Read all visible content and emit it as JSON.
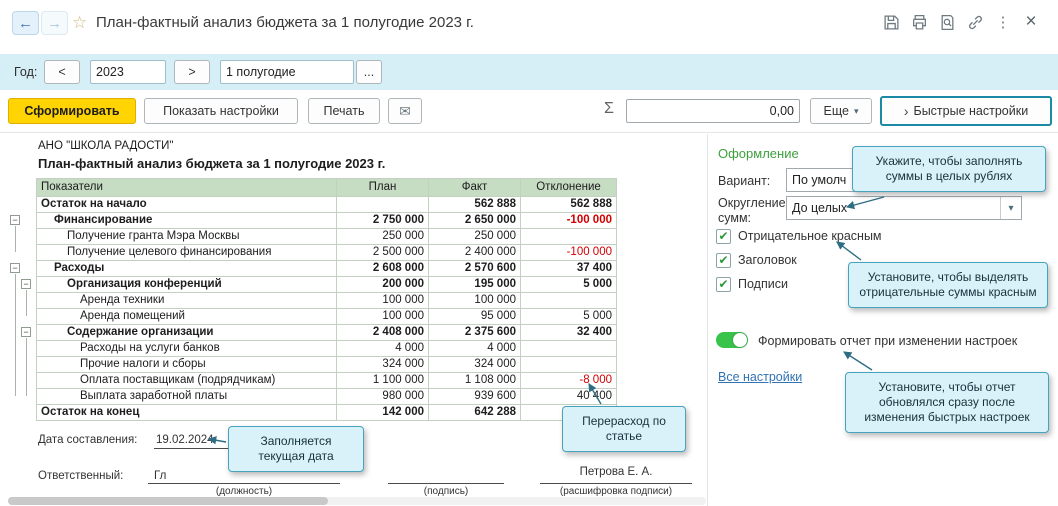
{
  "glyphs": {
    "back": "←",
    "forward": "→",
    "star": "☆",
    "more_v": "⋮",
    "close": "×",
    "mail": "✉",
    "sigma": "Σ",
    "combo_arrow": "▾",
    "chevron": "›",
    "minus": "−",
    "check": "✔",
    "dots": "..."
  },
  "icons": [
    "floppy-disk",
    "printer",
    "magnifier-document",
    "chain-link",
    "vertical-dots",
    "cross",
    "envelope",
    "star-outline",
    "back-arrow",
    "forward-arrow"
  ],
  "titlebar": {
    "title": "План-фактный анализ бюджета за 1 полугодие 2023 г."
  },
  "filterbar": {
    "year_label": "Год:",
    "prev": "<",
    "year": "2023",
    "next": ">",
    "period": "1 полугодие"
  },
  "toolbar": {
    "generate": "Сформировать",
    "show_settings": "Показать настройки",
    "print": "Печать",
    "sum_value": "0,00",
    "more": "Еще",
    "quick_settings": "Быстрые настройки"
  },
  "report": {
    "organization": "АНО \"ШКОЛА РАДОСТИ\"",
    "title": "План-фактный анализ бюджета за 1 полугодие 2023 г.",
    "columns": [
      "Показатели",
      "План",
      "Факт",
      "Отклонение"
    ],
    "rows": [
      {
        "label": "Остаток на начало",
        "plan": "",
        "fact": "562 888",
        "dev": "562 888",
        "bold": true,
        "level": 0
      },
      {
        "label": "Финансирование",
        "plan": "2 750 000",
        "fact": "2 650 000",
        "dev": "-100 000",
        "bold": true,
        "neg": true,
        "level": 1,
        "marker": 0
      },
      {
        "label": "Получение гранта Мэра Москвы",
        "plan": "250 000",
        "fact": "250 000",
        "dev": "",
        "level": 2
      },
      {
        "label": "Получение целевого финансирования",
        "plan": "2 500 000",
        "fact": "2 400 000",
        "dev": "-100 000",
        "neg": true,
        "level": 2
      },
      {
        "label": "Расходы",
        "plan": "2 608 000",
        "fact": "2 570 600",
        "dev": "37 400",
        "bold": true,
        "level": 1,
        "marker": 0
      },
      {
        "label": "Организация конференций",
        "plan": "200 000",
        "fact": "195 000",
        "dev": "5 000",
        "bold": true,
        "level": 2,
        "marker": 1
      },
      {
        "label": "Аренда техники",
        "plan": "100 000",
        "fact": "100 000",
        "dev": "",
        "level": 3
      },
      {
        "label": "Аренда помещений",
        "plan": "100 000",
        "fact": "95 000",
        "dev": "5 000",
        "level": 3
      },
      {
        "label": "Содержание организации",
        "plan": "2 408 000",
        "fact": "2 375 600",
        "dev": "32 400",
        "bold": true,
        "level": 2,
        "marker": 1
      },
      {
        "label": "Расходы на услуги банков",
        "plan": "4 000",
        "fact": "4 000",
        "dev": "",
        "level": 3
      },
      {
        "label": "Прочие налоги и сборы",
        "plan": "324 000",
        "fact": "324 000",
        "dev": "",
        "level": 3
      },
      {
        "label": "Оплата поставщикам (подрядчикам)",
        "plan": "1 100 000",
        "fact": "1 108 000",
        "dev": "-8 000",
        "neg": true,
        "level": 3
      },
      {
        "label": "Выплата заработной платы",
        "plan": "980 000",
        "fact": "939 600",
        "dev": "40 400",
        "level": 3
      },
      {
        "label": "Остаток на конец",
        "plan": "142 000",
        "fact": "642 288",
        "dev": "",
        "bold": true,
        "level": 0
      }
    ],
    "footer": {
      "date_label": "Дата составления:",
      "date_value": "19.02.2024",
      "responsible_label": "Ответственный:",
      "responsible_value": "Гл",
      "position_caption": "(должность)",
      "signature_caption": "(подпись)",
      "signer": "Петрова Е. А.",
      "transcript_caption": "(расшифровка подписи)"
    }
  },
  "settings": {
    "section": "Оформление",
    "variant_label": "Вариант:",
    "variant_value": "По умолч",
    "rounding_label": "Округление сумм:",
    "rounding_value": "До целых",
    "checkboxes": [
      {
        "label": "Отрицательное красным",
        "checked": true
      },
      {
        "label": "Заголовок",
        "checked": true
      },
      {
        "label": "Подписи",
        "checked": true
      }
    ],
    "toggle_label": "Формировать отчет при изменении настроек",
    "toggle_on": true,
    "all_settings": "Все настройки"
  },
  "tooltips": {
    "rounding": "Укажите, чтобы заполнять суммы в целых рублях",
    "negative": "Установите, чтобы выделять отрицательные суммы красным",
    "auto_update": "Установите, чтобы отчет обновлялся сразу после изменения быстрых настроек",
    "overspend": "Перерасход по статье",
    "date": "Заполняется текущая дата"
  },
  "colors": {
    "accent_yellow": "#ffd400",
    "table_header_green": "#c6dcc3",
    "negative_red": "#d40000",
    "tooltip_bg": "#d9f1f9",
    "tooltip_border": "#45a3bd",
    "highlight_teal": "#1b8aa5",
    "toggle_green": "#38c44a",
    "link_blue": "#3173b5",
    "section_green": "#3da03d",
    "filterbar_cyan": "#d6eef6"
  }
}
